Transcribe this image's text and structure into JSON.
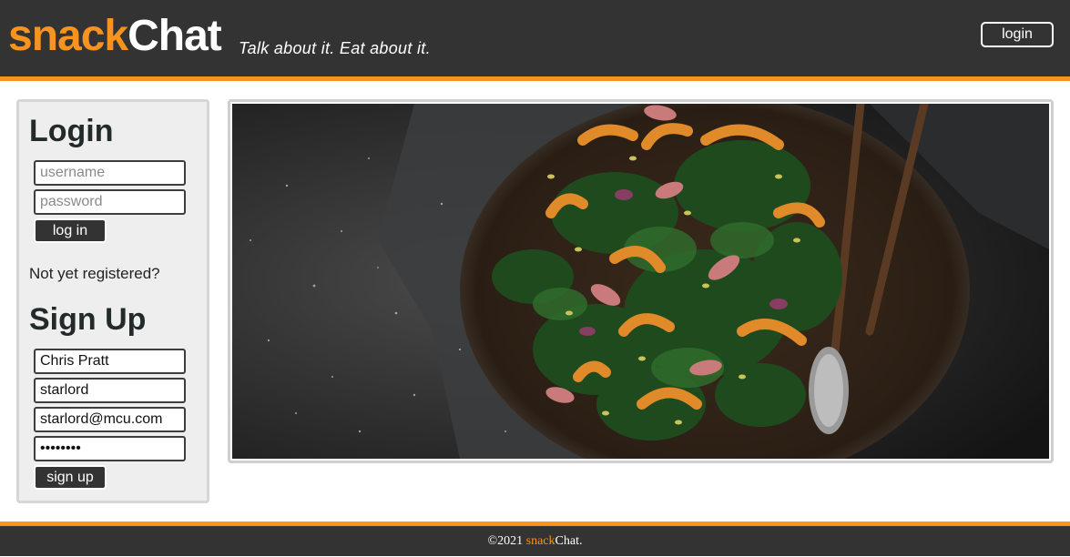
{
  "header": {
    "brand_snack": "snack",
    "brand_chat": "Chat",
    "tagline": "Talk about it. Eat about it.",
    "login_button": "login"
  },
  "login": {
    "title": "Login",
    "username_placeholder": "username",
    "password_placeholder": "password",
    "submit_label": "log in"
  },
  "not_registered": "Not yet registered?",
  "signup": {
    "title": "Sign Up",
    "name_value": "Chris Pratt",
    "username_value": "starlord",
    "email_value": "starlord@mcu.com",
    "password_value": "••••••••",
    "submit_label": "sign up"
  },
  "footer": {
    "prefix": "©2021 ",
    "brand_snack": "snack",
    "brand_chat": "Chat."
  },
  "colors": {
    "accent": "#f7931e",
    "header_bg": "#333333",
    "sidebar_bg": "#eeeeee"
  },
  "hero_image": {
    "icon": "food-salad-image"
  }
}
